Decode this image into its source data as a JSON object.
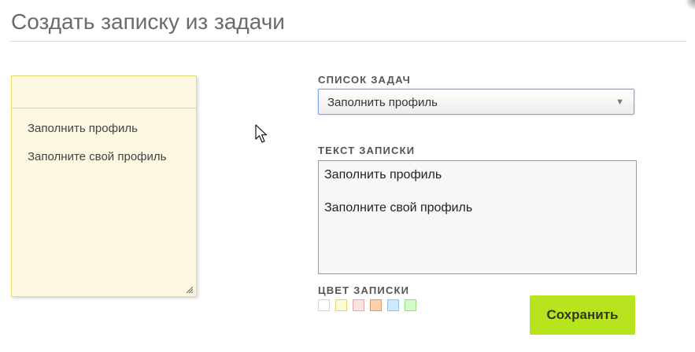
{
  "page": {
    "title": "Создать записку из задачи"
  },
  "note_preview": {
    "lines": [
      "Заполнить профиль",
      "Заполните свой профиль"
    ]
  },
  "form": {
    "task_list": {
      "label": "СПИСОК ЗАДАЧ",
      "selected": "Заполнить профиль",
      "arrow_icon": "triangle-down-icon"
    },
    "note_text": {
      "label": "ТЕКСТ ЗАПИСКИ",
      "lines": [
        "Заполнить профиль",
        "Заполните свой профиль"
      ]
    },
    "note_color": {
      "label": "ЦВЕТ ЗАПИСКИ",
      "swatches": [
        {
          "name": "white",
          "fill": "#ffffff",
          "border": "#d4d4d4"
        },
        {
          "name": "yellow",
          "fill": "#fdf8d8",
          "border": "#e3d56a"
        },
        {
          "name": "pink",
          "fill": "#fde2e2",
          "border": "#e8a7a7"
        },
        {
          "name": "orange",
          "fill": "#fbd2b0",
          "border": "#e09a60"
        },
        {
          "name": "blue",
          "fill": "#cfe8fb",
          "border": "#8cc1ea"
        },
        {
          "name": "green",
          "fill": "#d2fbc8",
          "border": "#97e07f"
        }
      ]
    },
    "save_label": "Сохранить"
  },
  "colors": {
    "accent": "#b7e31f",
    "note_background": "#fdf8e2",
    "note_border": "#e5dc6c"
  }
}
